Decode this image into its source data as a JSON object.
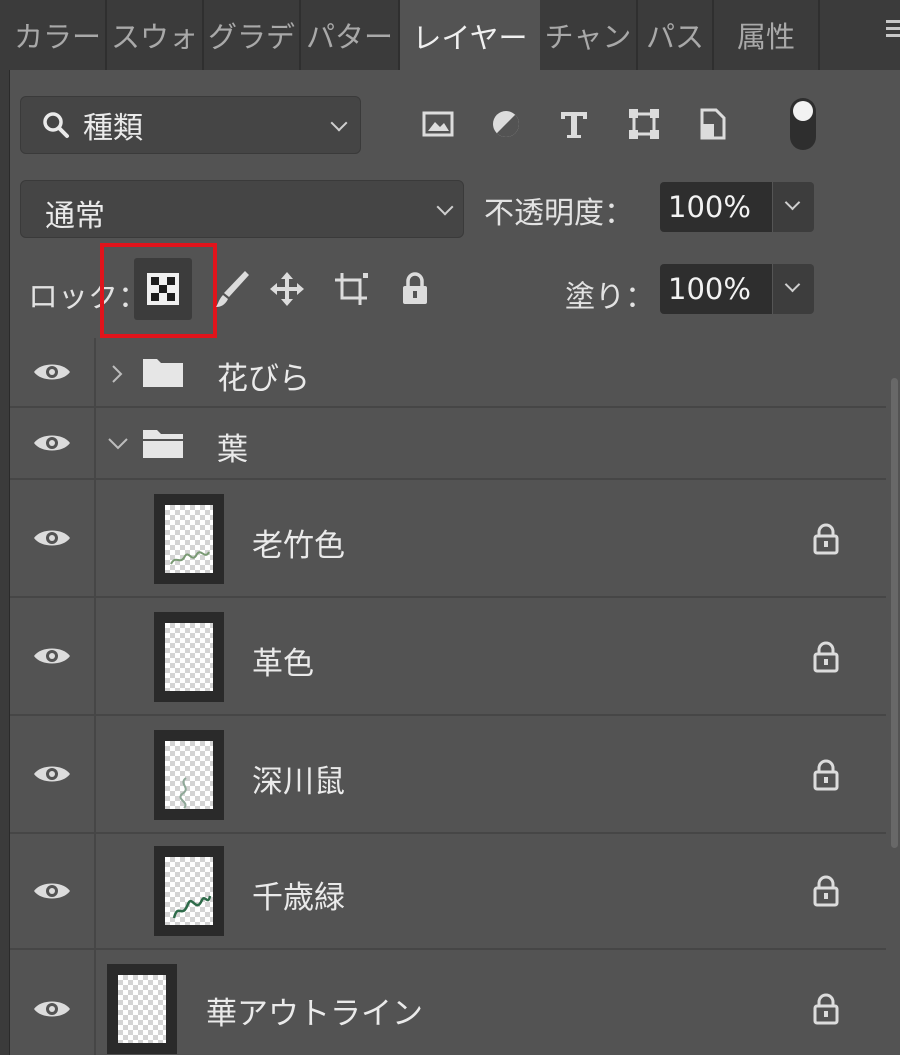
{
  "tabs": [
    "カラー",
    "スウォ",
    "グラデ",
    "パター",
    "レイヤー",
    "チャン",
    "パス",
    "属性"
  ],
  "active_tab": "レイヤー",
  "filter": {
    "kind_label": "種類"
  },
  "blend": {
    "mode": "通常",
    "opacity_label": "不透明度：",
    "opacity_value": "100%"
  },
  "lock": {
    "label": "ロック：",
    "fill_label": "塗り：",
    "fill_value": "100%"
  },
  "layers": [
    {
      "name": "花びら",
      "type": "group",
      "expanded": false
    },
    {
      "name": "葉",
      "type": "group",
      "expanded": true
    },
    {
      "name": "老竹色",
      "type": "layer",
      "locked": true
    },
    {
      "name": "革色",
      "type": "layer",
      "locked": true
    },
    {
      "name": "深川鼠",
      "type": "layer",
      "locked": true
    },
    {
      "name": "千歳緑",
      "type": "layer",
      "locked": true
    },
    {
      "name": "華アウトライン",
      "type": "layer",
      "locked": true
    }
  ],
  "colors": {
    "panel_bg": "#535353",
    "tabbar_bg": "#3b3b3b",
    "highlight": "#e0141b"
  }
}
